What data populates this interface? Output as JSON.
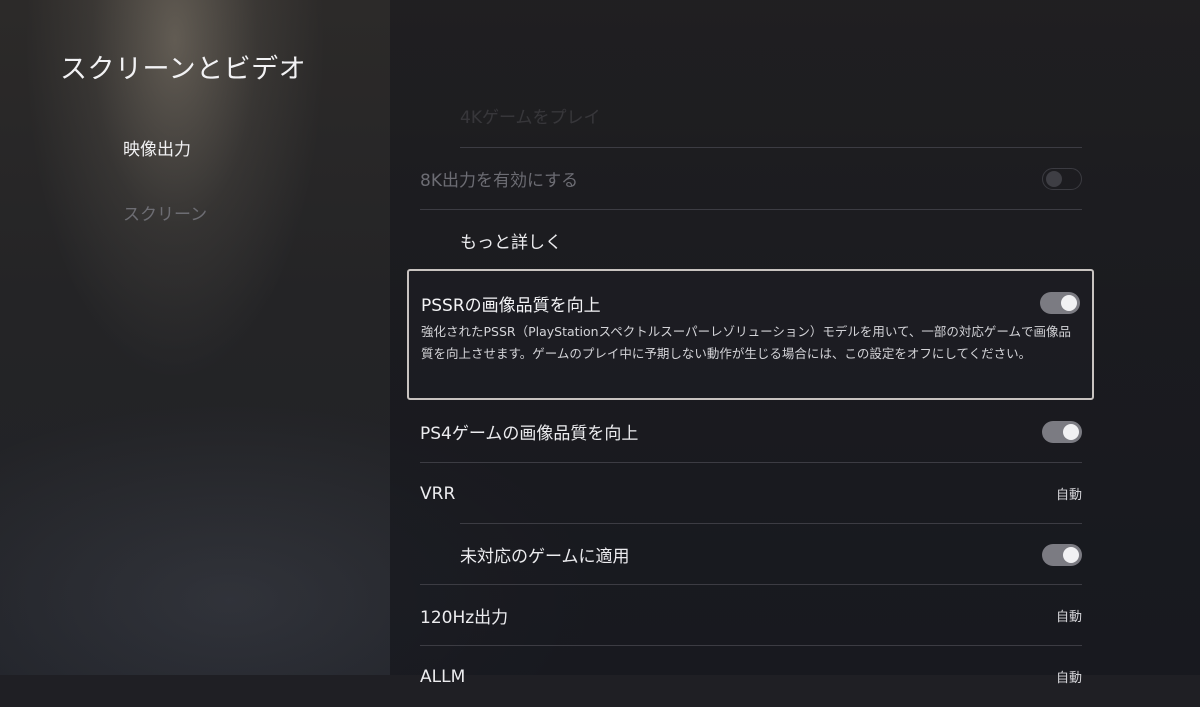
{
  "page": {
    "title": "スクリーンとビデオ"
  },
  "sidebar": {
    "items": [
      {
        "label": "映像出力",
        "active": true
      },
      {
        "label": "スクリーン",
        "active": false
      }
    ]
  },
  "settings": {
    "faded_top_label": "4Kゲームをプレイ",
    "enable_8k": {
      "label": "8K出力を有効にする",
      "enabled": false
    },
    "more_details": {
      "label": "もっと詳しく"
    },
    "pssr": {
      "label": "PSSRの画像品質を向上",
      "on": true,
      "description": "強化されたPSSR（PlayStationスペクトルスーパーレゾリューション）モデルを用いて、一部の対応ゲームで画像品質を向上させます。ゲームのプレイ中に予期しない動作が生じる場合には、この設定をオフにしてください。"
    },
    "ps4_quality": {
      "label": "PS4ゲームの画像品質を向上",
      "on": true
    },
    "vrr": {
      "label": "VRR",
      "value": "自動"
    },
    "apply_unsupported": {
      "label": "未対応のゲームに適用",
      "on": true
    },
    "hz120": {
      "label": "120Hz出力",
      "value": "自動"
    },
    "allm": {
      "label": "ALLM",
      "value": "自動"
    }
  },
  "colors": {
    "focus_border": "#c8c3c0",
    "toggle_on": "#7b7b82",
    "separator": "#3c3c43"
  }
}
